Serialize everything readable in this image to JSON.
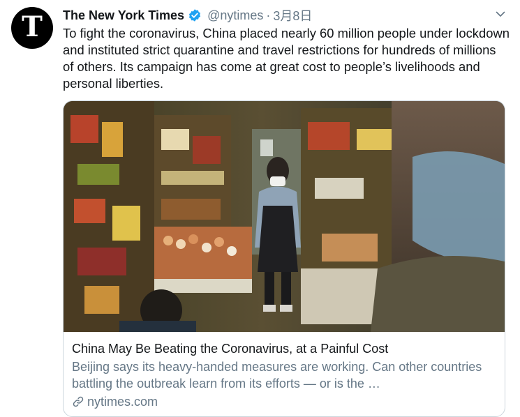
{
  "tweet": {
    "avatar_letter": "T",
    "display_name": "The New York Times",
    "handle": "@nytimes",
    "separator": "·",
    "date": "3月8日",
    "text": "To fight the coronavirus, China placed nearly 60 million people under lockdown and instituted strict quarantine and travel restrictions for hundreds of millions of others. Its campaign has come at great cost to people’s livelihoods and personal liberties.",
    "verified_color": "#1da1f2",
    "icons": {
      "verified": "verified-badge-icon",
      "menu": "chevron-down-icon",
      "link": "link-icon"
    }
  },
  "card": {
    "title": "China May Be Beating the Coronavirus, at a Painful Cost",
    "description": "Beijing says its heavy-handed measures are working. Can other countries battling the outbreak learn from its efforts — or is the …",
    "domain": "nytimes.com",
    "image_alt": "Masked shopkeeper in a grocery store"
  }
}
